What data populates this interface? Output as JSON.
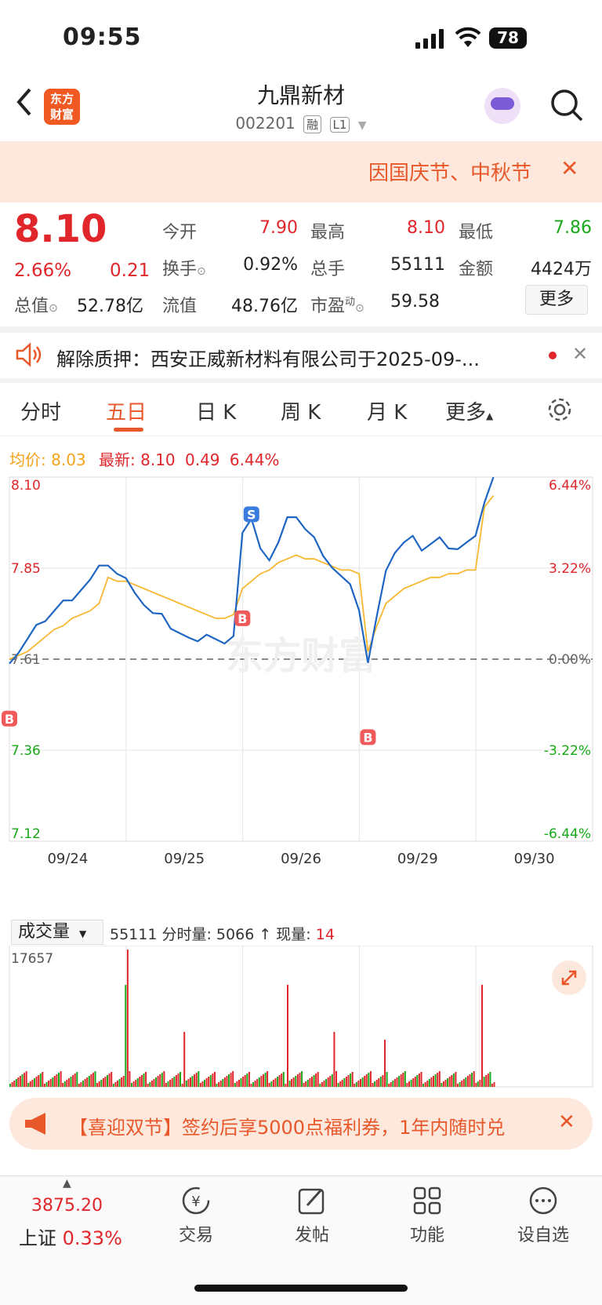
{
  "status": {
    "time": "09:55",
    "battery": "78"
  },
  "header": {
    "back_icon": "chevron-left-icon",
    "logo_line1": "东方",
    "logo_line2": "财富",
    "stock_name": "九鼎新材",
    "stock_code": "002201",
    "tag_rong": "融",
    "tag_level": "L1"
  },
  "notice": {
    "text": "因国庆节、中秋节",
    "close": "✕"
  },
  "quote": {
    "price": "8.10",
    "pct": "2.66%",
    "change": "0.21",
    "open_label": "今开",
    "open": "7.90",
    "high_label": "最高",
    "high": "8.10",
    "low_label": "最低",
    "low": "7.86",
    "turnover_label": "换手",
    "turnover": "0.92%",
    "volume_label": "总手",
    "volume": "55111",
    "amount_label": "金额",
    "amount": "4424万",
    "mcap_label": "总值",
    "mcap": "52.78亿",
    "float_label": "流值",
    "float": "48.76亿",
    "pe_label": "市盈",
    "pe_sup": "动",
    "pe": "59.58",
    "more": "更多"
  },
  "pledge": {
    "text": "解除质押：西安正威新材料有限公司于2025-09-..."
  },
  "tabs": [
    "分时",
    "五日",
    "日 K",
    "周 K",
    "月 K",
    "更多"
  ],
  "chart_info": {
    "avg_label": "均价:",
    "avg": "8.03",
    "latest_label": "最新:",
    "latest": "8.10",
    "chg": "0.49",
    "pct": "6.44%"
  },
  "chart_data": {
    "type": "line",
    "title": "",
    "x": [
      "09/24",
      "09/25",
      "09/26",
      "09/29",
      "09/30"
    ],
    "y_left_ticks": [
      "8.10",
      "7.85",
      "7.61",
      "7.36",
      "7.12"
    ],
    "y_right_ticks": [
      "6.44%",
      "3.22%",
      "0.00%",
      "-3.22%",
      "-6.44%"
    ],
    "ylim": [
      7.12,
      8.1
    ],
    "prev_close": 7.61,
    "series": [
      {
        "values": [
          7.61,
          7.63,
          7.66,
          7.69,
          7.72,
          7.74,
          7.76,
          7.78,
          7.8,
          7.82,
          7.85,
          7.87,
          7.84,
          7.82,
          7.8,
          7.76,
          7.73,
          7.72,
          7.7,
          7.68,
          7.66,
          7.67,
          7.68,
          7.66,
          7.64,
          7.68,
          7.95,
          7.98,
          7.92,
          7.88,
          7.92,
          7.98,
          8.0,
          7.96,
          7.93,
          7.9,
          7.86,
          7.83,
          7.8,
          7.75,
          7.6,
          7.72,
          7.86,
          7.9,
          7.92,
          7.93,
          7.91,
          7.92,
          7.93,
          7.92,
          7.91,
          7.92,
          7.93,
          8.04,
          8.1
        ]
      },
      {
        "values": [
          7.61,
          7.62,
          7.63,
          7.65,
          7.67,
          7.69,
          7.7,
          7.72,
          7.73,
          7.74,
          7.76,
          7.83,
          7.82,
          7.82,
          7.81,
          7.8,
          7.79,
          7.78,
          7.77,
          7.76,
          7.75,
          7.74,
          7.73,
          7.72,
          7.72,
          7.73,
          7.8,
          7.82,
          7.84,
          7.85,
          7.87,
          7.88,
          7.89,
          7.88,
          7.88,
          7.87,
          7.86,
          7.85,
          7.85,
          7.84,
          7.63,
          7.7,
          7.76,
          7.78,
          7.8,
          7.81,
          7.82,
          7.83,
          7.83,
          7.84,
          7.84,
          7.85,
          7.85,
          8.02,
          8.05
        ]
      }
    ],
    "trade_marks": [
      {
        "label": "S",
        "x_index": 27,
        "value": 8.0
      },
      {
        "label": "B",
        "x_index": 26,
        "value": 7.72
      },
      {
        "label": "B",
        "x_index": 40,
        "value": 7.4
      },
      {
        "label": "B",
        "x_index": 0,
        "value": 7.45
      }
    ],
    "volume_label": "成交量",
    "volume_info": "55111 分时量: 5066 ↑ 现量:",
    "volume_now": "14",
    "volume_max": "17657",
    "watermark": "东方财富"
  },
  "promo": {
    "text": "【喜迎双节】签约后享5000点福利券，1年内随时兑",
    "close": "✕"
  },
  "bottom_nav": {
    "index_value": "3875.20",
    "index_name": "上证",
    "index_pct": "0.33%",
    "items": [
      "交易",
      "发帖",
      "功能",
      "设自选"
    ]
  },
  "colors": {
    "accent": "#e8582a",
    "up": "#e0262b",
    "down": "#18a818",
    "price_line": "#1f66c4",
    "avg_line": "#f7b731"
  }
}
